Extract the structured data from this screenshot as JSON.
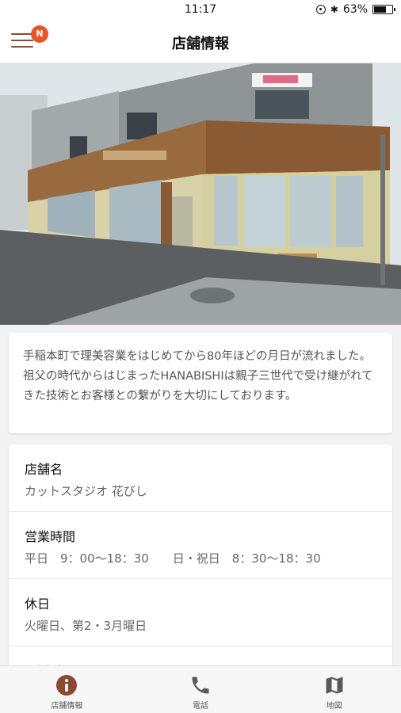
{
  "status": {
    "time": "11:17",
    "battery": "63%",
    "battery_level": 0.63
  },
  "nav": {
    "title": "店舗情報",
    "badge": "N"
  },
  "intro": {
    "text": "手稲本町で理美容業をはじめてから80年ほどの月日が流れました。祖父の時代からはじまったHANABISHIは親子三世代で受け継がれてきた技術とお客様との繋がりを大切にしております。"
  },
  "info": {
    "rows": [
      {
        "label": "店舗名",
        "value": "カットスタジオ 花びし"
      },
      {
        "label": "営業時間",
        "value": "平日　9：00〜18：30　　日・祝日　8：30〜18：30"
      },
      {
        "label": "休日",
        "value": "火曜日、第2・3月曜日"
      },
      {
        "label": "電話番号",
        "value": ""
      }
    ]
  },
  "tabs": [
    {
      "label": "店舗情報",
      "icon": "info-icon"
    },
    {
      "label": "電話",
      "icon": "phone-icon"
    },
    {
      "label": "地図",
      "icon": "map-icon"
    }
  ],
  "colors": {
    "accent": "#8b4a32",
    "badge": "#e8552b",
    "icon_gray": "#5a5a5a"
  }
}
